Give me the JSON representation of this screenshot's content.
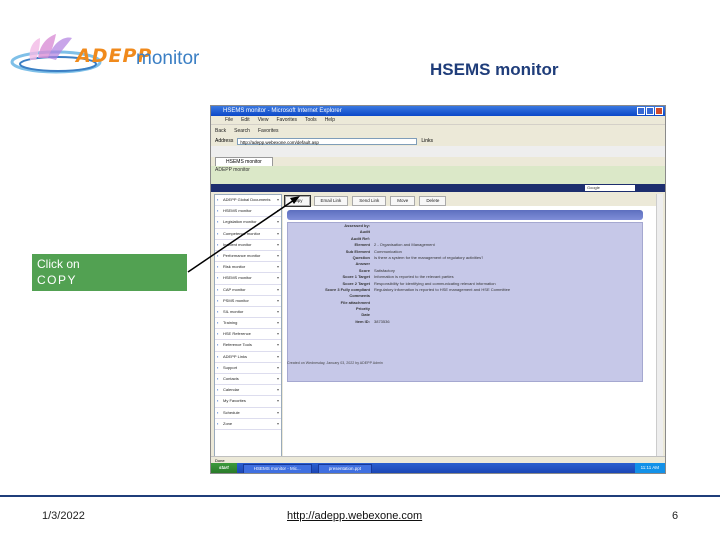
{
  "logo": {
    "brand": "ADEPP",
    "suffix": "monitor"
  },
  "slide": {
    "title": "HSEMS monitor"
  },
  "callout": {
    "line1": "Click on",
    "line2": "COPY"
  },
  "footer": {
    "date": "1/3/2022",
    "url": "http://adepp.webexone.com",
    "page": "6"
  },
  "browser": {
    "title": "HSEMS monitor - Microsoft Internet Explorer",
    "menu": [
      "File",
      "Edit",
      "View",
      "Favorites",
      "Tools",
      "Help"
    ],
    "toolbar": [
      "Back",
      "Search",
      "Favorites"
    ],
    "address_label": "Address",
    "address": "http://adepp.webexone.com/default.asp",
    "links_label": "Links",
    "tab": "HSEMS monitor",
    "page_header": "ADEPP monitor",
    "search_value": "Google",
    "status": "Done"
  },
  "sidebar": {
    "items": [
      "ADEPP Global Documents",
      "HSEMS monitor",
      "Legislation monitor",
      "Competence monitor",
      "Incident monitor",
      "Performance monitor",
      "Risk monitor",
      "HSEMS monitor",
      "CAP monitor",
      "PSMS monitor",
      "SIL monitor",
      "Training",
      "HSE Reference",
      "Reference Tools",
      "ADEPP Links",
      "Support",
      "Contacts",
      "Calendar",
      "My Favorites",
      "Schedule",
      "Zone"
    ]
  },
  "actions": [
    "Copy",
    "Email Link",
    "Send Link",
    "Move",
    "Delete"
  ],
  "record": {
    "fields": [
      {
        "label": "Assessed by:",
        "value": ""
      },
      {
        "label": "Audit",
        "value": ""
      },
      {
        "label": "Audit Ref:",
        "value": ""
      },
      {
        "label": "Element",
        "value": "2 - Organisation and Management"
      },
      {
        "label": "Sub Element",
        "value": "Communication"
      },
      {
        "label": "Question",
        "value": "Is there a system for the management of regulatory activities?"
      },
      {
        "label": "Answer",
        "value": ""
      },
      {
        "label": "Score",
        "value": "Satisfactory"
      },
      {
        "label": "Score 1 Target",
        "value": "Information is reported to the relevant parties"
      },
      {
        "label": "Score 2 Target",
        "value": "Responsibility for identifying and communicating relevant information"
      },
      {
        "label": "Score 3 Fully compliant",
        "value": "Regulatory information is reported to HSE management and HSE Committee"
      },
      {
        "label": "Comments",
        "value": ""
      },
      {
        "label": "File attachment",
        "value": ""
      },
      {
        "label": "Priority",
        "value": ""
      },
      {
        "label": "Date",
        "value": ""
      },
      {
        "label": "Item ID:",
        "value": "3873536"
      }
    ],
    "footnote": "Created on Wednesday, January 03, 2022 by ADEPP Admin"
  },
  "taskbar": {
    "start": "start",
    "tasks": [
      "HSEMS monitor - Mic...",
      "presentation.ppt"
    ],
    "clock": "11:11 AM"
  },
  "colors": {
    "callout": "#52a152",
    "title": "#1f3d7a",
    "logo_orange": "#f08a1c",
    "logo_blue": "#3b7fc4"
  }
}
